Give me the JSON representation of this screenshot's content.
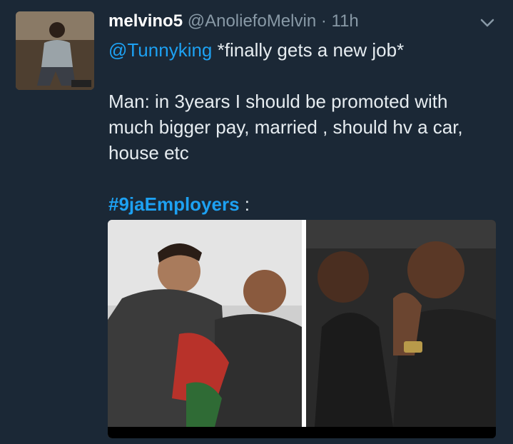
{
  "tweet": {
    "display_name": "melvino5",
    "handle": "@AnoliefoMelvin",
    "separator": "·",
    "time": "11h",
    "mention": "@Tunnyking",
    "line1_rest": " *finally gets a new job*",
    "line2": "Man: in 3years I should be promoted with",
    "line3": "much bigger pay, married , should hv a car,",
    "line4": "house etc",
    "hashtag": "#9jaEmployers",
    "hashtag_suffix": " :"
  },
  "icons": {
    "menu": "chevron-down-icon"
  },
  "colors": {
    "background": "#1b2836",
    "link": "#1da1f2",
    "muted": "#8899a6",
    "text": "#e6ecf0"
  }
}
